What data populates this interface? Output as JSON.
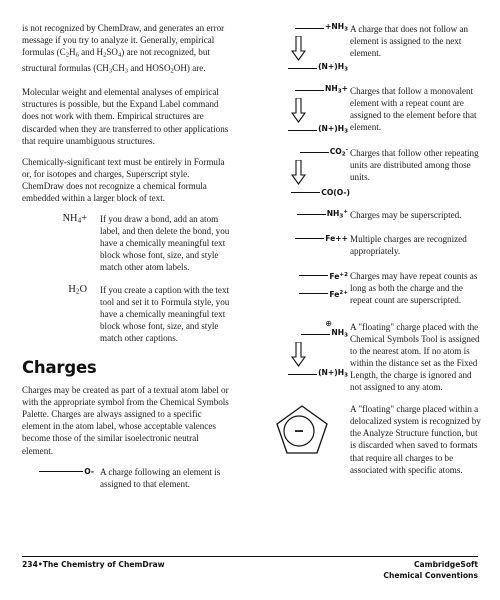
{
  "document": {
    "section_heading": "Charges",
    "footer": {
      "left": "234•The Chemistry of ChemDraw",
      "right_line1": "CambridgeSoft",
      "right_line2": "Chemical Conventions"
    }
  },
  "left_column": {
    "paragraphs": [
      "is not recognized by ChemDraw, and generates an error message if you try to analyze it. Generally, empirical formulas (C2H6 and H2SO4) are not recognized, but structural formulas (CH3CH3 and HOSO2OH) are.",
      "Molecular weight and elemental analyses of empirical structures is possible, but the Expand Label command does not work with them. Empirical structures are discarded when they are transferred to other applications that require unambiguous structures.",
      "Chemically-significant text must be entirely in Formula or, for isotopes and charges, Superscript style. ChemDraw does not recognize a chemical formula embedded within a larger block of text."
    ],
    "definitions": [
      {
        "term": "NH4+",
        "description": "If you draw a bond, add an atom label, and then delete the bond, you have a chemically meaningful text block whose font, size, and style match other atom labels."
      },
      {
        "term": "H2O",
        "description": "If you create a caption with the text tool and set it to Formula style, you have a chemically meaningful text block whose font, size, and style match other captions."
      }
    ],
    "charges_intro": "Charges may be created as part of a textual atom label or with the appropriate symbol from the Chemical Symbols Palette. Charges are always assigned to a specific element in the atom label, whose acceptable valences become those of the similar isoelectronic neutral element.",
    "charge_example": {
      "structure_label": "O-",
      "description": "A charge following an element is assigned to that element."
    }
  },
  "right_column": {
    "entries": [
      {
        "name": "charge-not-following-element",
        "before_label": "+NH3",
        "after_label": "(N+)H3",
        "has_arrow": true,
        "description": "A charge that does not follow an element is assigned to the next element."
      },
      {
        "name": "charge-monovalent-repeat-count",
        "before_label": "NH3+",
        "after_label": "(N+)H3",
        "has_arrow": true,
        "description": "Charges that follow a monovalent element with a repeat count are assigned to the element before that element."
      },
      {
        "name": "charge-repeating-units",
        "before_label": "CO2-",
        "after_label": "CO(O-)",
        "has_arrow": true,
        "description": "Charges that follow other repeating units are distributed among those units."
      },
      {
        "name": "charge-superscripted",
        "before_label": "NH3+",
        "after_label": "",
        "has_arrow": false,
        "description": "Charges may be superscripted."
      },
      {
        "name": "charge-multiple",
        "before_label": "Fe++",
        "after_label": "",
        "has_arrow": false,
        "description": "Multiple charges are recognized appropriately."
      },
      {
        "name": "charge-repeat-count-superscript",
        "before_label": "Fe+2",
        "after_label": "Fe2+",
        "has_arrow": false,
        "description": "Charges may have repeat counts as long as both the charge and the repeat count are superscripted."
      },
      {
        "name": "floating-charge-nearest-atom",
        "before_label": "NH3",
        "after_label": "(N+)H3",
        "has_arrow": true,
        "has_floating_circle_charge": true,
        "description": "A \"floating\" charge placed with the Chemical Symbols Tool is assigned to the nearest atom. If no atom is within the distance set as the Fixed Length, the charge is ignored and not assigned to any atom."
      },
      {
        "name": "floating-charge-delocalized",
        "before_label": "",
        "after_label": "",
        "has_arrow": false,
        "is_pentagon_anion": true,
        "pentagon_charge": "-",
        "description": "A \"floating\" charge placed within a delocalized system is recognized by the Analyze Structure function, but is discarded when saved to formats that require all charges to be associated with specific atoms."
      }
    ]
  },
  "colors": {
    "text": "#1a1a1a",
    "ink": "#111111",
    "background": "#ffffff"
  }
}
